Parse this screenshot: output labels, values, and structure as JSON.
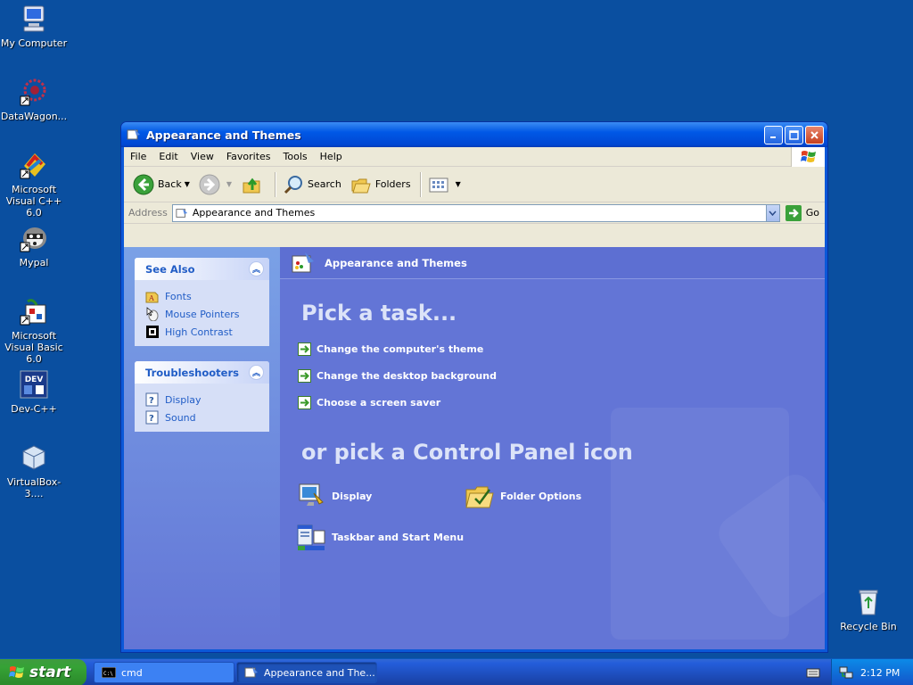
{
  "desktop": {
    "icons": [
      {
        "label": "My Computer",
        "icon": "my-computer-icon"
      },
      {
        "label": "DataWagon...",
        "icon": "datawagon-icon"
      },
      {
        "label": "Microsoft Visual C++ 6.0",
        "icon": "visual-cpp-icon"
      },
      {
        "label": "Mypal",
        "icon": "mypal-icon"
      },
      {
        "label": "Microsoft Visual Basic 6.0",
        "icon": "visual-basic-icon"
      },
      {
        "label": "Dev-C++",
        "icon": "dev-cpp-icon"
      },
      {
        "label": "VirtualBox-3....",
        "icon": "virtualbox-icon"
      },
      {
        "label": "Recycle Bin",
        "icon": "recycle-bin-icon"
      }
    ]
  },
  "window": {
    "title": "Appearance and Themes",
    "menu": [
      "File",
      "Edit",
      "View",
      "Favorites",
      "Tools",
      "Help"
    ],
    "toolbar": {
      "back": "Back",
      "search": "Search",
      "folders": "Folders"
    },
    "address": {
      "label": "Address",
      "value": "Appearance and Themes",
      "go": "Go"
    },
    "see_also": {
      "title": "See Also",
      "items": [
        {
          "label": "Fonts",
          "icon": "fonts-icon"
        },
        {
          "label": "Mouse Pointers",
          "icon": "mouse-icon"
        },
        {
          "label": "High Contrast",
          "icon": "contrast-icon"
        }
      ]
    },
    "troubleshooters": {
      "title": "Troubleshooters",
      "items": [
        {
          "label": "Display",
          "icon": "help-icon"
        },
        {
          "label": "Sound",
          "icon": "help-icon"
        }
      ]
    },
    "main": {
      "header": "Appearance and Themes",
      "pick_task": "Pick a task...",
      "tasks": [
        "Change the computer's theme",
        "Change the desktop background",
        "Choose a screen saver"
      ],
      "or_pick": "or pick a Control Panel icon",
      "icons": [
        "Display",
        "Folder Options",
        "Taskbar and Start Menu"
      ]
    }
  },
  "taskbar": {
    "start": "start",
    "items": [
      "cmd",
      "Appearance and The..."
    ],
    "clock": "2:12 PM"
  }
}
